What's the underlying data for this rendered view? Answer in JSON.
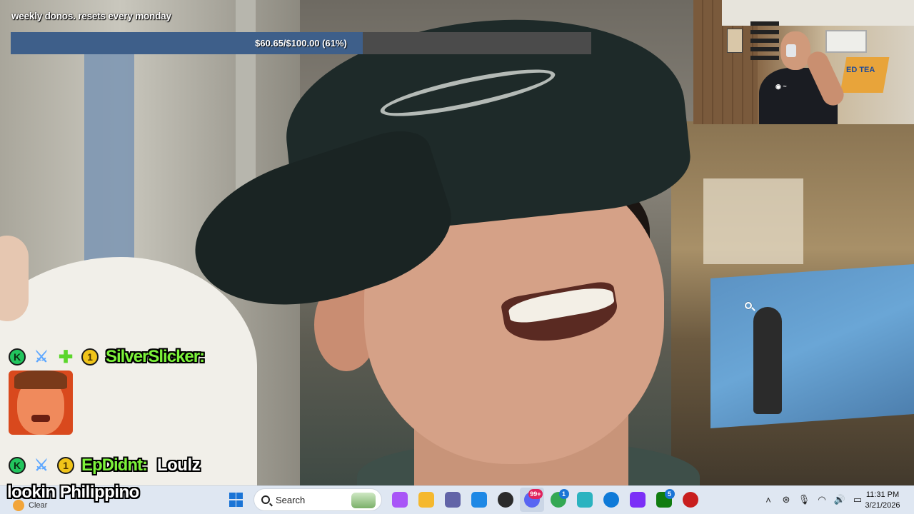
{
  "donation_goal": {
    "title": "weekly donos. resets every monday",
    "progress_text": "$60.65/$100.00 (61%)",
    "raised": 60.65,
    "goal": 100.0,
    "percent": 61,
    "fill_color": "#3e5f8a",
    "track_color": "#4b4b4b"
  },
  "webcam": {
    "banner_text": "ED TEA"
  },
  "chat": {
    "messages": [
      {
        "badges": [
          "k-badge-icon",
          "sword-icon",
          "plus-badge-icon",
          "sub-1-badge-icon"
        ],
        "badge_one": "1",
        "badge_k": "K",
        "username": "SilverSlicker:",
        "message": "",
        "emote": "crying-face-emote"
      },
      {
        "badges": [
          "k-badge-icon",
          "sword-icon",
          "sub-1-badge-icon"
        ],
        "badge_one": "1",
        "badge_k": "K",
        "username": "EpDidnt:",
        "message": "Loulz"
      },
      {
        "message": "lookin  Philippino"
      }
    ],
    "username_color": "#7cf23a"
  },
  "taskbar": {
    "weather_label": "Clear",
    "search_label": "Search",
    "apps": [
      {
        "name": "copilot-icon",
        "color": "#a855f7"
      },
      {
        "name": "file-explorer-icon",
        "color": "#f5b82e"
      },
      {
        "name": "teams-icon",
        "color": "#6264a7"
      },
      {
        "name": "store-icon",
        "color": "#1e88e5"
      },
      {
        "name": "obs-icon",
        "color": "#2b2b2b",
        "badge": ""
      },
      {
        "name": "discord-icon",
        "color": "#5865f2",
        "badge": "99+"
      },
      {
        "name": "chrome-icon",
        "color": "#34a853",
        "badge": "1"
      },
      {
        "name": "snipping-icon",
        "color": "#2bb3c0"
      },
      {
        "name": "edge-icon",
        "color": "#0f7ad8"
      },
      {
        "name": "streaming-app-icon",
        "color": "#7b2ff7"
      },
      {
        "name": "xbox-icon",
        "color": "#107c10",
        "badge": "5"
      },
      {
        "name": "record-app-icon",
        "color": "#c81e1e"
      }
    ],
    "tray": {
      "chevron": "˄",
      "items": [
        "network-status-icon",
        "microphone-icon",
        "wifi-icon",
        "volume-icon",
        "battery-icon"
      ]
    },
    "time": "11:31 PM",
    "date": "3/21/2026"
  }
}
